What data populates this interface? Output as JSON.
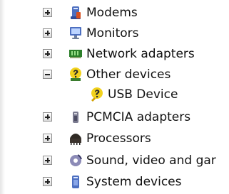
{
  "window": {
    "panel": "device-tree"
  },
  "tree": {
    "items": [
      {
        "label": "Modems",
        "state": "collapsed",
        "icon": "modem-icon"
      },
      {
        "label": "Monitors",
        "state": "collapsed",
        "icon": "monitor-icon"
      },
      {
        "label": "Network adapters",
        "state": "collapsed",
        "icon": "network-adapter-icon"
      },
      {
        "label": "Other devices",
        "state": "expanded",
        "icon": "unknown-device-icon"
      },
      {
        "label": "USB Device",
        "state": "child",
        "icon": "usb-device-warning-icon"
      },
      {
        "label": "PCMCIA adapters",
        "state": "collapsed",
        "icon": "pcmcia-icon"
      },
      {
        "label": "Processors",
        "state": "collapsed",
        "icon": "processor-icon"
      },
      {
        "label": "Sound, video and gar",
        "state": "collapsed",
        "icon": "sound-video-icon"
      },
      {
        "label": "System devices",
        "state": "collapsed",
        "icon": "system-devices-icon"
      }
    ]
  },
  "colors": {
    "text": "#111111",
    "expander_border": "#8c8c8c",
    "warning_yellow": "#f2d21d",
    "device_green": "#2c7f2a",
    "monitor_blue": "#4d6fc0"
  }
}
